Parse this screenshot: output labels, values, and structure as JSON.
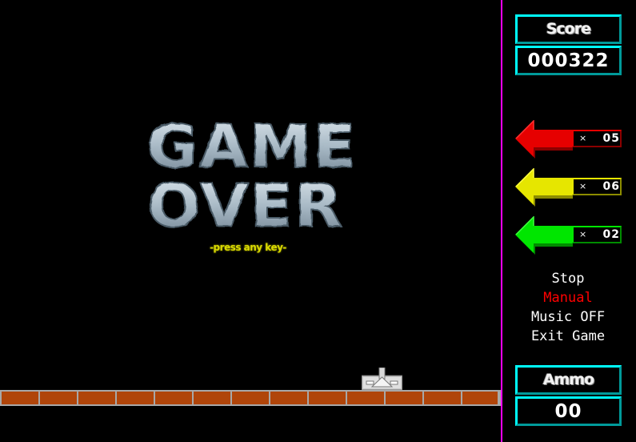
{
  "game": {
    "title_line1": "GAME",
    "title_line2": "OVER",
    "prompt": "-press any key-",
    "floor_bricks": 13
  },
  "sidebar": {
    "score": {
      "label": "Score",
      "value": "000322"
    },
    "arrows": [
      {
        "color": "red",
        "count_prefix": "×",
        "count": "05",
        "fill": "#e60000",
        "shade": "#8c0000",
        "light": "#ff3030"
      },
      {
        "color": "yellow",
        "count_prefix": "×",
        "count": "06",
        "fill": "#e6e600",
        "shade": "#8c8c00",
        "light": "#ffff40"
      },
      {
        "color": "green",
        "count_prefix": "×",
        "count": "02",
        "fill": "#00e600",
        "shade": "#008c00",
        "light": "#40ff40"
      }
    ],
    "menu": [
      {
        "label": "Stop",
        "color": "#ffffff"
      },
      {
        "label": "Manual",
        "color": "#ff0000"
      },
      {
        "label": "Music OFF",
        "color": "#ffffff"
      },
      {
        "label": "Exit Game",
        "color": "#ffffff"
      }
    ],
    "ammo": {
      "label": "Ammo",
      "value": "00"
    }
  },
  "colors": {
    "divider": "#ff00ff",
    "panel_border": "#00ffff",
    "brick": "#b0450a",
    "mortar": "#a8a8a8",
    "prompt": "#d9d900"
  }
}
